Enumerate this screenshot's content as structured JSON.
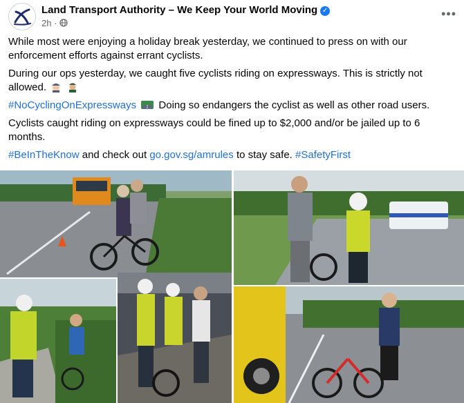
{
  "post": {
    "page_name": "Land Transport Authority – We Keep Your World Moving",
    "verified_icon": "verified-badge-icon",
    "time": "2h",
    "privacy_icon": "globe-icon",
    "more_icon": "more-options-icon",
    "paragraph1": "While most were enjoying a holiday break yesterday, we continued to press on with our enforcement efforts against errant cyclists.",
    "paragraph2": "During our ops yesterday, we caught five cyclists riding on expressways. This is strictly not allowed.",
    "hashtag1": "#NoCyclingOnExpressways",
    "paragraph3_rest": "Doing so endangers the cyclist as well as other road users.",
    "paragraph4": "Cyclists caught riding on expressways could be fined up to $2,000 and/or be jailed up to 6 months.",
    "hashtag2": "#BeInTheKnow",
    "text_middle": "and check out",
    "link": "go.gov.sg/amrules",
    "text_after_link": "to stay safe.",
    "hashtag3": "#SafetyFirst"
  },
  "colors": {
    "link": "#216fdb",
    "secondary_text": "#65676b",
    "verified": "#1877f2"
  }
}
